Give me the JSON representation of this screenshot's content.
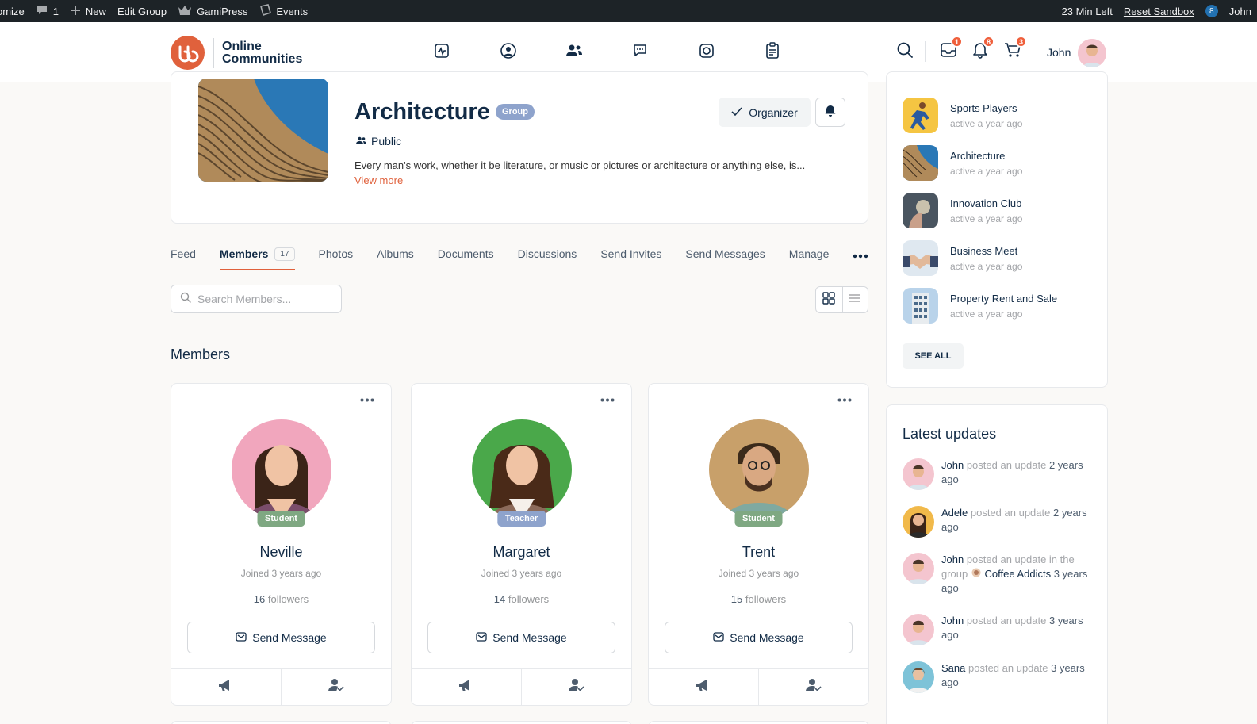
{
  "adminbar": {
    "customize": "omize",
    "comments_count": "1",
    "new_label": "New",
    "edit_group": "Edit Group",
    "gamipress": "GamiPress",
    "events": "Events",
    "time_left": "23 Min Left",
    "reset_sandbox": "Reset Sandbox",
    "badge": "8",
    "user": "John"
  },
  "header": {
    "logo_text": "Online Communities",
    "nav_icons": [
      "activity-icon",
      "profile-icon",
      "groups-icon",
      "forums-icon",
      "media-icon",
      "docs-icon"
    ],
    "active_nav": "groups-icon",
    "messages_badge": "1",
    "notifications_badge": "8",
    "cart_badge": "3",
    "user_name": "John"
  },
  "group": {
    "title": "Architecture",
    "badge": "Group",
    "privacy": "Public",
    "description": "Every man's work, whether it be literature, or music or pictures or architecture or anything else, is...",
    "view_more": "View more",
    "organizer_button": "Organizer"
  },
  "tabs": [
    {
      "label": "Feed"
    },
    {
      "label": "Members",
      "count": "17",
      "active": true
    },
    {
      "label": "Photos"
    },
    {
      "label": "Albums"
    },
    {
      "label": "Documents"
    },
    {
      "label": "Discussions"
    },
    {
      "label": "Send Invites"
    },
    {
      "label": "Send Messages"
    },
    {
      "label": "Manage"
    }
  ],
  "search": {
    "placeholder": "Search Members..."
  },
  "members_section": {
    "title": "Members"
  },
  "members": [
    {
      "name": "Neville",
      "role": "Student",
      "role_color": "#7fa882",
      "joined": "Joined 3 years ago",
      "followers_count": "16",
      "followers_label": "followers",
      "send_message": "Send Message"
    },
    {
      "name": "Margaret",
      "role": "Teacher",
      "role_color": "#8ea3cc",
      "joined": "Joined 3 years ago",
      "followers_count": "14",
      "followers_label": "followers",
      "send_message": "Send Message"
    },
    {
      "name": "Trent",
      "role": "Student",
      "role_color": "#7fa882",
      "joined": "Joined 3 years ago",
      "followers_count": "15",
      "followers_label": "followers",
      "send_message": "Send Message"
    }
  ],
  "sidebar_groups": {
    "items": [
      {
        "name": "Sports Players",
        "meta": "active a year ago"
      },
      {
        "name": "Architecture",
        "meta": "active a year ago"
      },
      {
        "name": "Innovation Club",
        "meta": "active a year ago"
      },
      {
        "name": "Business Meet",
        "meta": "active a year ago"
      },
      {
        "name": "Property Rent and Sale",
        "meta": "active a year ago"
      }
    ],
    "see_all": "SEE ALL"
  },
  "latest_updates": {
    "title": "Latest updates",
    "items": [
      {
        "who": "John",
        "action": "posted an update",
        "when": "2 years ago"
      },
      {
        "who": "Adele",
        "action": "posted an update",
        "when": "2 years ago"
      },
      {
        "who": "John",
        "action": "posted an update in the group",
        "group": "Coffee Addicts",
        "when": "3 years ago"
      },
      {
        "who": "John",
        "action": "posted an update",
        "when": "3 years ago"
      },
      {
        "who": "Sana",
        "action": "posted an update",
        "when": "3 years ago"
      }
    ]
  },
  "colors": {
    "accent": "#e0613c",
    "badge_red": "#ef5f3b",
    "text_dark": "#122b46",
    "admin_bar": "#1d2327"
  }
}
